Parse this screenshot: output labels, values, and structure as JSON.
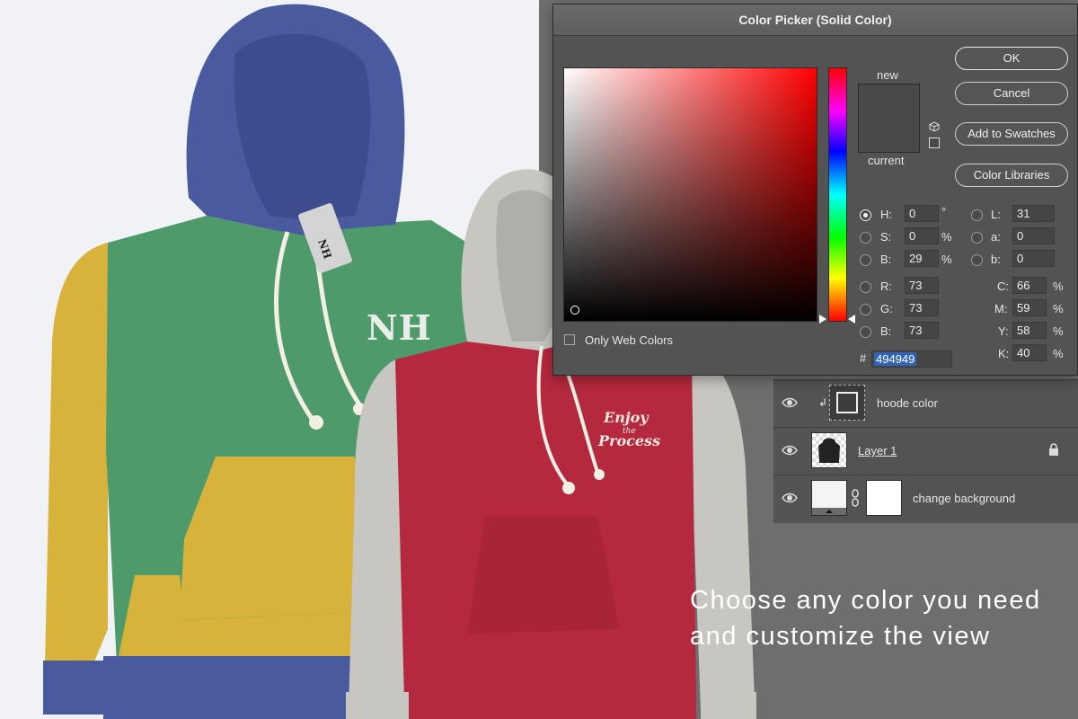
{
  "colors": {
    "hoodie_blue": "#4a5a9e",
    "hoodie_green": "#4f9a6a",
    "hoodie_yellow": "#d8b33c",
    "hoodie_red": "#b4293d",
    "hoodie_grey": "#c8c6c0",
    "workspace": "#6e6e6e",
    "panel": "#535353",
    "selected_color": "#494949"
  },
  "hoodies": {
    "chest_logo": "NH",
    "tag_text": "NH",
    "print_line1": "Enjoy",
    "print_line2": "the",
    "print_line3": "Process"
  },
  "picker": {
    "title": "Color Picker (Solid Color)",
    "new_label": "new",
    "current_label": "current",
    "new_color": "#494949",
    "current_color": "#494949",
    "buttons": {
      "ok": "OK",
      "cancel": "Cancel",
      "add": "Add to Swatches",
      "libraries": "Color Libraries"
    },
    "only_web": "Only Web Colors",
    "hsb": {
      "h": {
        "label": "H:",
        "value": "0",
        "unit": "°"
      },
      "s": {
        "label": "S:",
        "value": "0",
        "unit": "%"
      },
      "b": {
        "label": "B:",
        "value": "29",
        "unit": "%"
      }
    },
    "rgb": {
      "r": {
        "label": "R:",
        "value": "73"
      },
      "g": {
        "label": "G:",
        "value": "73"
      },
      "b": {
        "label": "B:",
        "value": "73"
      }
    },
    "lab": {
      "l": {
        "label": "L:",
        "value": "31"
      },
      "a": {
        "label": "a:",
        "value": "0"
      },
      "b": {
        "label": "b:",
        "value": "0"
      }
    },
    "cmyk": {
      "c": {
        "label": "C:",
        "value": "66",
        "unit": "%"
      },
      "m": {
        "label": "M:",
        "value": "59",
        "unit": "%"
      },
      "y": {
        "label": "Y:",
        "value": "58",
        "unit": "%"
      },
      "k": {
        "label": "K:",
        "value": "40",
        "unit": "%"
      }
    },
    "hex": {
      "label": "#",
      "value": "494949"
    }
  },
  "layers": [
    {
      "name": "hoode color",
      "icon": "eye-icon"
    },
    {
      "name": "Layer 1",
      "icon": "eye-icon",
      "locked": true
    },
    {
      "name": "change background",
      "icon": "eye-icon"
    }
  ],
  "caption": {
    "line1": "Choose any color you need",
    "line2": "and customize the view"
  }
}
